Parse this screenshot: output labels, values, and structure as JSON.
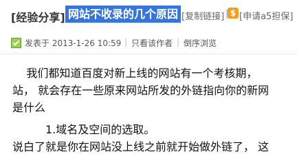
{
  "header": {
    "tag": "[经验分享]",
    "title": "网站不收录的几个原因",
    "copy_link": "[复制链接]",
    "separator": "|",
    "guarantee_icon": "$",
    "guarantee_link": "[申请a5担保]"
  },
  "meta": {
    "posted": "发表于 2013-1-26 10:59",
    "divider": "|",
    "only_author": "只看该作者",
    "reverse_order": "倒序浏览"
  },
  "content": {
    "line1": "    我们都知道百度对新上线的网站有一个考核期，",
    "line2": "站， 就会存在一些原来网站所发的外链指向你的新网",
    "line3": "是什么",
    "sub_heading": "1.域名及空间的选取。",
    "line4": "说白了就是你在网站没上线之前就开始做外链了， 这"
  },
  "colors": {
    "title_highlight": "#3875d7",
    "guarantee_icon_bg": "#f0a020",
    "post_icon": "#9ccf4f"
  },
  "icons": {
    "post": "post-check-icon",
    "guarantee": "guarantee-dollar-icon"
  }
}
